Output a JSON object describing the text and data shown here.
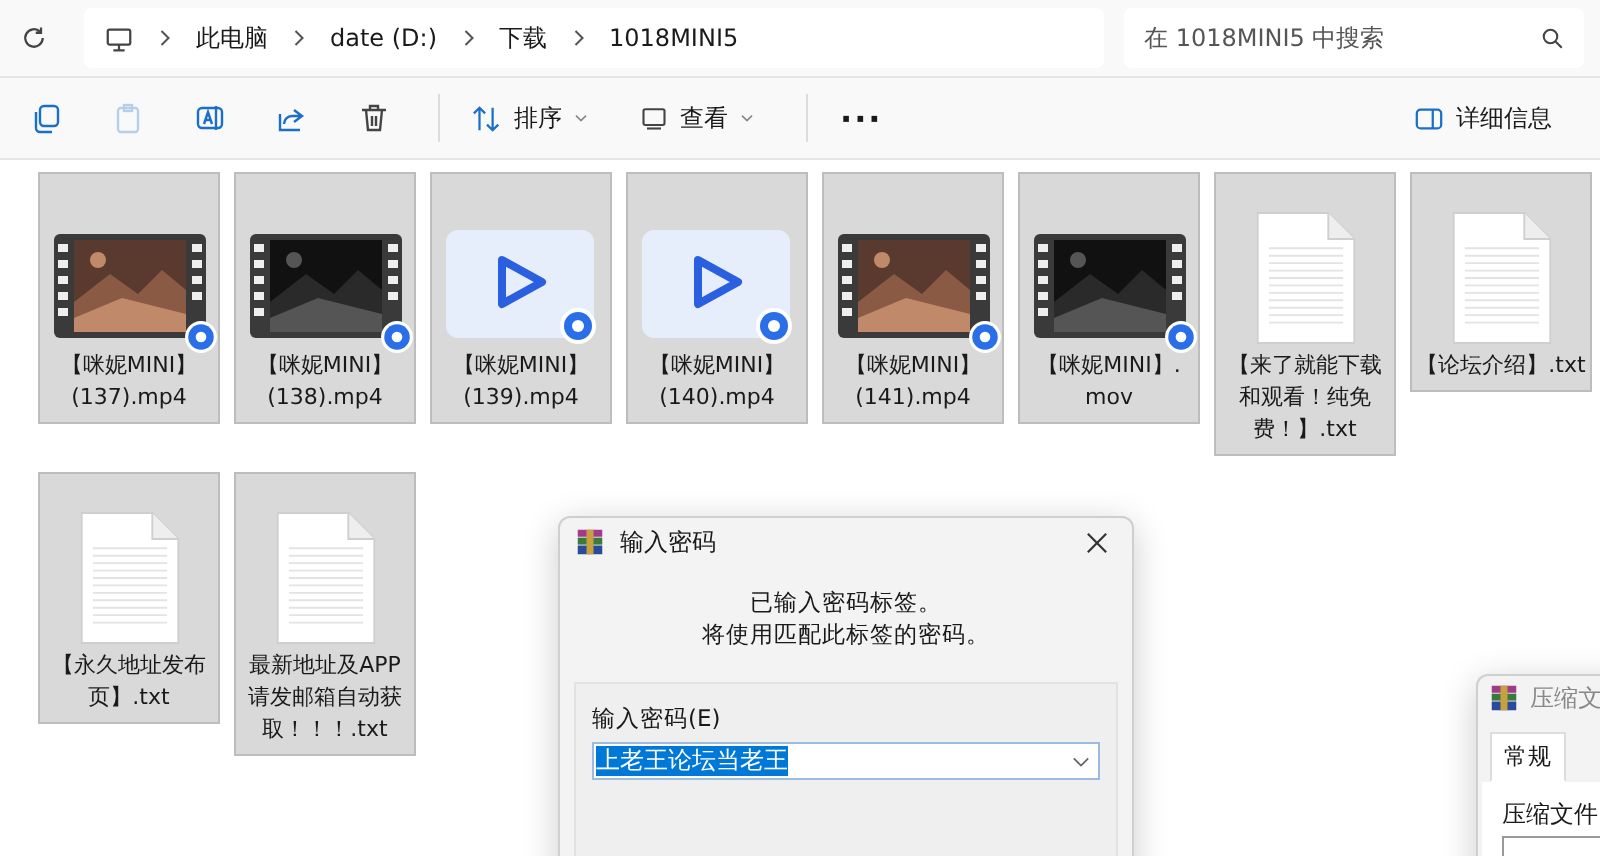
{
  "address_bar": {
    "crumbs": [
      "此电脑",
      "date (D:)",
      "下载",
      "1018MINI5"
    ],
    "search": {
      "placeholder": "在 1018MINI5 中搜索"
    }
  },
  "toolbar": {
    "icon_buttons": [
      {
        "kind": "copy",
        "disabled": false
      },
      {
        "kind": "paste",
        "disabled": true
      },
      {
        "kind": "rename",
        "disabled": false
      },
      {
        "kind": "share",
        "disabled": false
      },
      {
        "kind": "delete",
        "disabled": false
      }
    ],
    "sort": {
      "label": "排序"
    },
    "view": {
      "label": "查看"
    },
    "more": {
      "label": "···"
    },
    "details": {
      "label": "详细信息"
    }
  },
  "files": [
    {
      "kind": "thumbnail",
      "selected": true,
      "name_lines": [
        "【咪妮MINI】",
        "(137).mp4"
      ]
    },
    {
      "kind": "thumbnail",
      "selected": true,
      "name_lines": [
        "【咪妮MINI】",
        "(138).mp4"
      ]
    },
    {
      "kind": "video",
      "selected": true,
      "name_lines": [
        "【咪妮MINI】",
        "(139).mp4"
      ]
    },
    {
      "kind": "video",
      "selected": true,
      "name_lines": [
        "【咪妮MINI】",
        "(140).mp4"
      ]
    },
    {
      "kind": "thumbnail",
      "selected": true,
      "name_lines": [
        "【咪妮MINI】",
        "(141).mp4"
      ]
    },
    {
      "kind": "thumbnail",
      "selected": true,
      "name_lines": [
        "【咪妮MINI】.",
        "mov"
      ]
    },
    {
      "kind": "text",
      "selected": true,
      "name_lines": [
        "【来了就能下载",
        "和观看！纯免",
        "费！】.txt"
      ]
    },
    {
      "kind": "text",
      "selected": true,
      "name_lines": [
        "【论坛介绍】.txt"
      ]
    },
    {
      "kind": "text",
      "selected": true,
      "name_lines": [
        "【永久地址发布",
        "页】.txt"
      ]
    },
    {
      "kind": "text",
      "selected": true,
      "name_lines": [
        "最新地址及APP",
        "请发邮箱自动获",
        "取！！！.txt"
      ]
    }
  ],
  "password_dialog": {
    "title": "输入密码",
    "message_lines": [
      "已输入密码标签。",
      "将使用匹配此标签的密码。"
    ],
    "field_label": "输入密码(E)",
    "value": "上老王论坛当老王",
    "value_selected": true
  },
  "archive_dialog": {
    "title": "压缩文",
    "tabs": [
      {
        "label": "常规",
        "selected": true
      }
    ],
    "field_label": "压缩文件"
  }
}
